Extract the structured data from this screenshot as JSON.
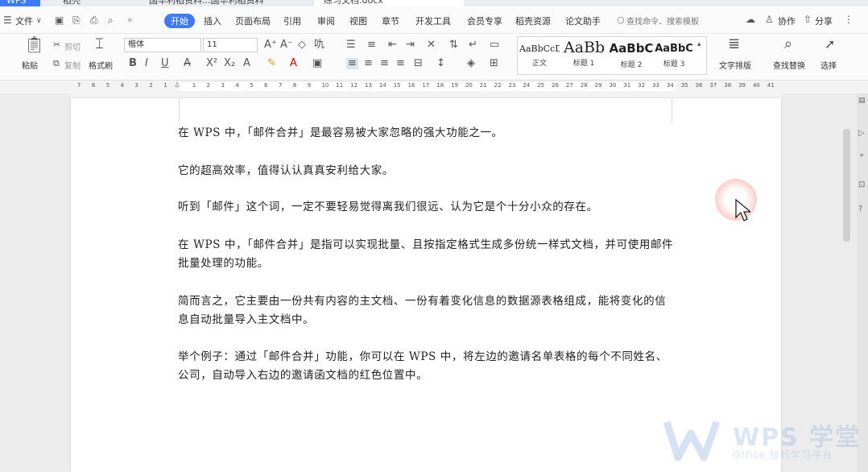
{
  "tabs": [
    {
      "label": "WPS"
    },
    {
      "label": "稻壳"
    },
    {
      "label": "国华利稻资料...国华利稻资料"
    },
    {
      "label": "练习文档.docx"
    }
  ],
  "menu": {
    "file_label": "文件",
    "items": [
      "开始",
      "插入",
      "页面布局",
      "引用",
      "审阅",
      "视图",
      "章节",
      "开发工具",
      "会员专享",
      "稻壳资源",
      "论文助手"
    ],
    "search_placeholder": "查找命令、搜索模板",
    "collab_label": "协作",
    "share_label": "分享"
  },
  "ribbon": {
    "paste_label": "粘贴",
    "cut_label": "剪切",
    "copy_label": "复制",
    "format_painter_label": "格式刷",
    "font_name": "楷体",
    "font_size": "11",
    "styles": [
      {
        "preview": "AaBbCcD",
        "name": "正文"
      },
      {
        "preview": "AaBb",
        "name": "标题 1"
      },
      {
        "preview": "AaBbC",
        "name": "标题 2"
      },
      {
        "preview": "AaBbC",
        "name": "标题 3"
      }
    ],
    "typesetting_label": "文字排版",
    "find_replace_label": "查找替换",
    "select_label": "选择"
  },
  "ruler": {
    "ticks": [
      "7",
      "6",
      "5",
      "4",
      "3",
      "2",
      "1",
      "",
      "1",
      "2",
      "3",
      "4",
      "5",
      "6",
      "7",
      "8",
      "9",
      "10",
      "11",
      "12",
      "13",
      "14",
      "15",
      "16",
      "17",
      "18",
      "19",
      "20",
      "21",
      "22",
      "23",
      "24",
      "25",
      "26",
      "27",
      "28",
      "29",
      "30",
      "31",
      "32",
      "33",
      "34",
      "35",
      "36",
      "37",
      "38",
      "39",
      "40",
      "41"
    ]
  },
  "document": {
    "paragraphs": [
      "在 WPS 中，「邮件合并」是最容易被大家忽略的强大功能之一。",
      "它的超高效率，值得认认真真安利给大家。",
      "听到「邮件」这个词，一定不要轻易觉得离我们很远、认为它是个十分小众的存在。",
      "在 WPS 中，「邮件合并」是指可以实现批量、且按指定格式生成多份统一样式文档，并可使用邮件批量处理的功能。",
      "简而言之，它主要由一份共有内容的主文档、一份有着变化信息的数据源表格组成，能将变化的信息自动批量导入主文档中。",
      "举个例子：通过「邮件合并」功能，你可以在 WPS 中，将左边的邀请名单表格的每个不同姓名、公司，自动导入右边的邀请函文档的红色位置中。"
    ]
  },
  "watermark": {
    "brand": "WPS 学堂",
    "tagline": "Office 技巧学习平台"
  },
  "colors": {
    "accent": "#3d7bfa",
    "page": "#ffffff",
    "text": "#222222"
  }
}
